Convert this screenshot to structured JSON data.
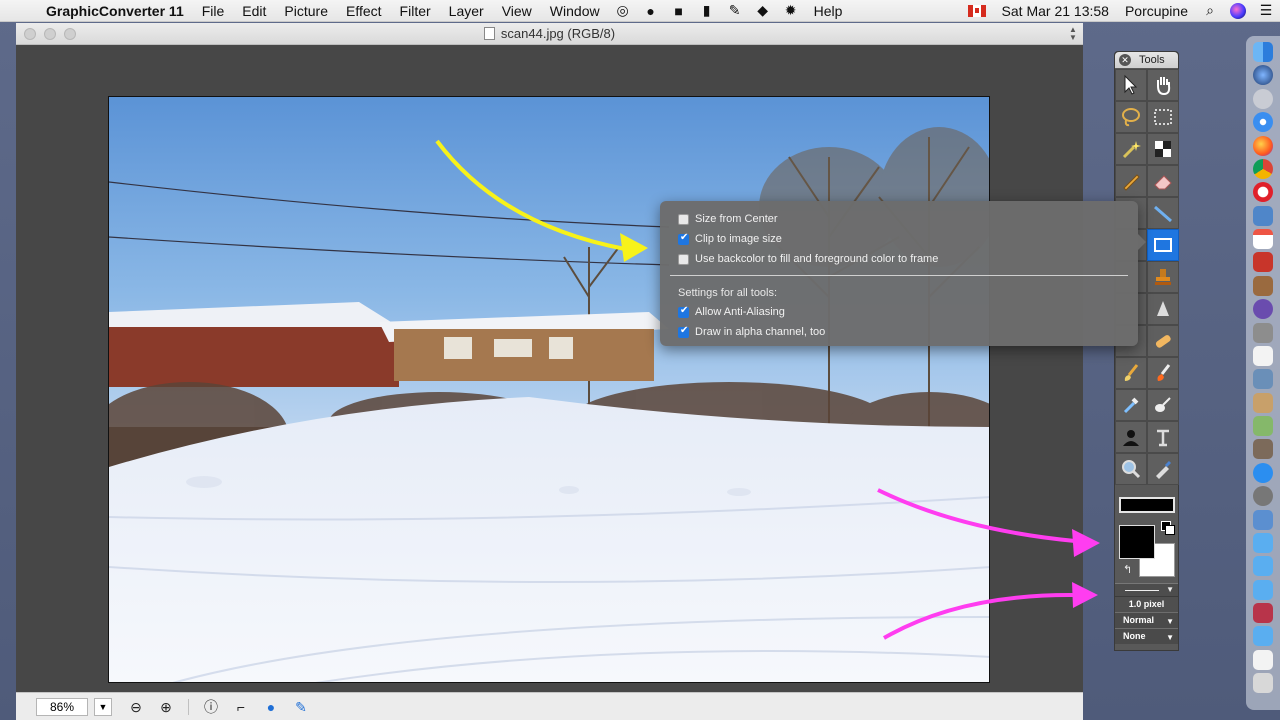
{
  "menubar": {
    "apple": "",
    "app_name": "GraphicConverter 11",
    "menus": [
      "File",
      "Edit",
      "Picture",
      "Effect",
      "Filter",
      "Layer",
      "View",
      "Window"
    ],
    "help": "Help",
    "clock": "Sat Mar 21  13:58",
    "user": "Porcupine",
    "status_icons": [
      "target-icon",
      "person-icon",
      "camera-icon",
      "clipboard-icon",
      "pen-icon",
      "evernote-icon",
      "gear-icon"
    ]
  },
  "window": {
    "title": "scan44.jpg (RGB/8)",
    "zoom": "86%"
  },
  "popover": {
    "options": [
      {
        "label": "Size from Center",
        "checked": false
      },
      {
        "label": "Clip to image size",
        "checked": true
      },
      {
        "label": "Use backcolor to fill and foreground color to frame",
        "checked": false
      }
    ],
    "section_heading": "Settings for all tools:",
    "all_tools_options": [
      {
        "label": "Allow Anti-Aliasing",
        "checked": true
      },
      {
        "label": "Draw in alpha channel, too",
        "checked": true
      }
    ]
  },
  "tools": {
    "title": "Tools",
    "line_width": "1.0 pixel",
    "blend_mode": "Normal",
    "pattern": "None",
    "colors": {
      "foreground": "#000000",
      "background": "#ffffff",
      "active_tool": "#1f76e0"
    }
  },
  "annotations": {
    "yellow_arrow": "#f7f21a",
    "magenta_arrow": "#ff3df0"
  }
}
